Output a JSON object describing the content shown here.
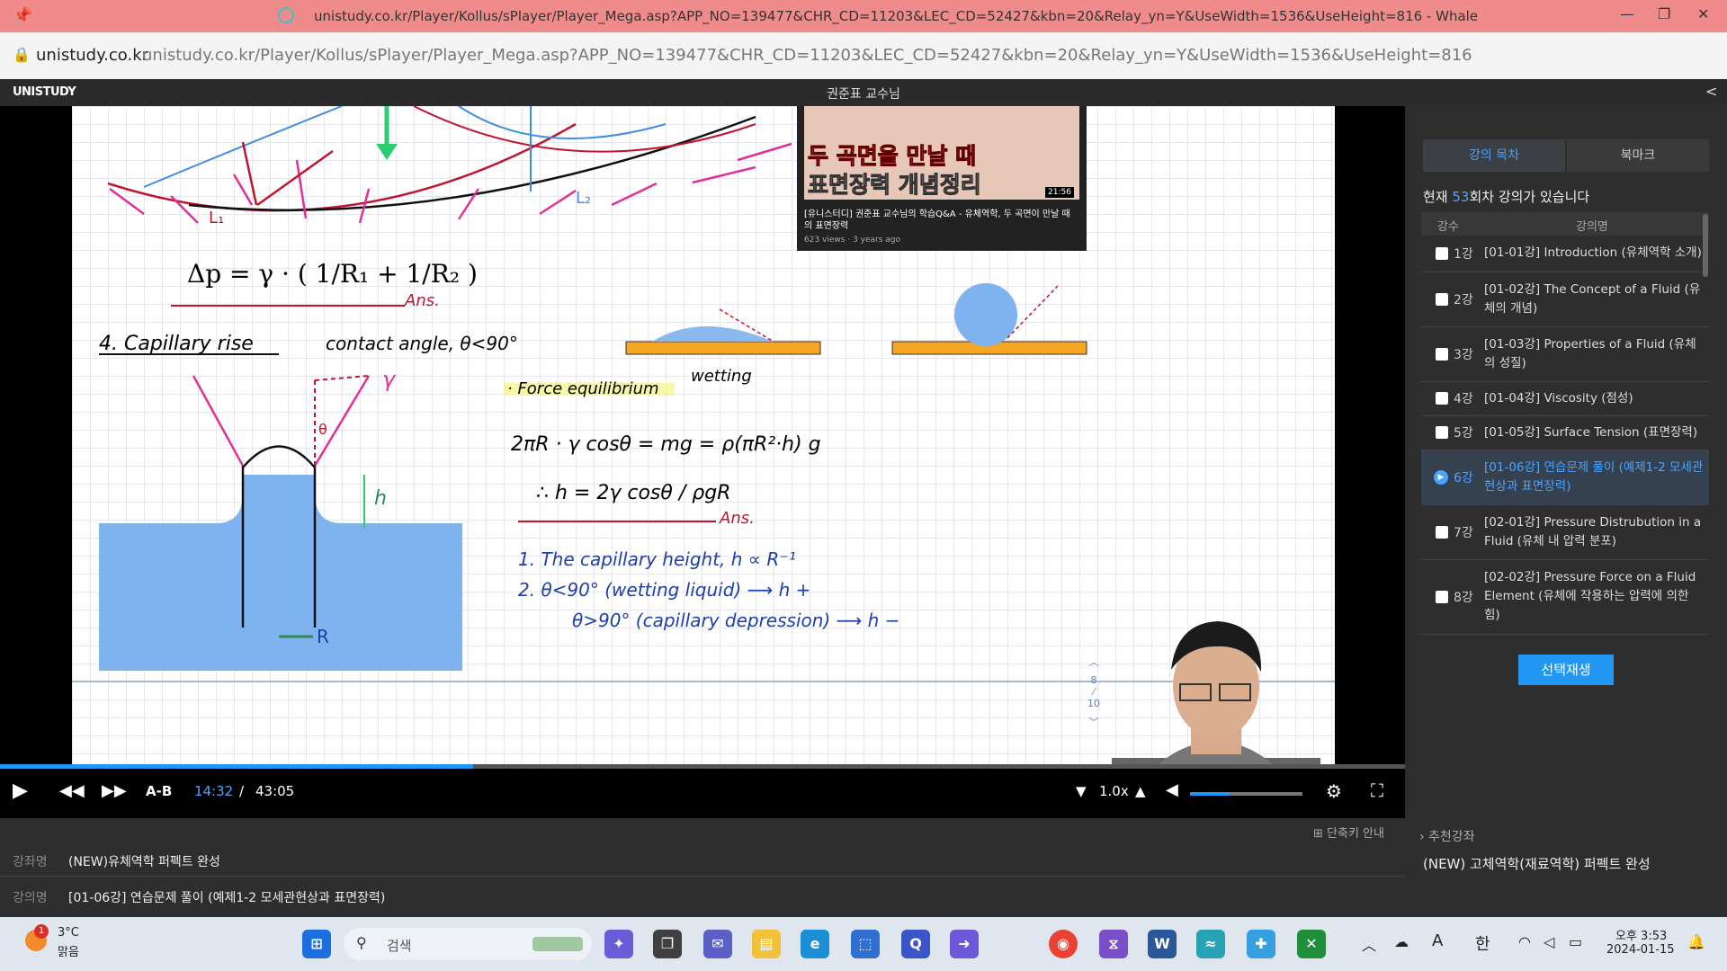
{
  "window": {
    "title": "unistudy.co.kr/Player/Kollus/sPlayer/Player_Mega.asp?APP_NO=139477&CHR_CD=11203&LEC_CD=52427&kbn=20&Relay_yn=Y&UseWidth=1536&UseHeight=816 - Whale",
    "controls": {
      "minimize": "—",
      "restore": "❐",
      "close": "✕"
    }
  },
  "address_bar": {
    "host": "unistudy.co.kr",
    "url": "unistudy.co.kr/Player/Kollus/sPlayer/Player_Mega.asp?APP_NO=139477&CHR_CD=11203&LEC_CD=52427&kbn=20&Relay_yn=Y&UseWidth=1536&UseHeight=816"
  },
  "app_header": {
    "logo": "UNISTUDY",
    "professor": "권준표 교수님"
  },
  "video": {
    "thumbnail": {
      "line1": "두 곡면을 만날 때",
      "line2": "표면장력 개념정리",
      "duration": "21:56",
      "caption": "[유니스터디] 권준표 교수님의 학습Q&A - 유체역학, 두 곡면이 만날 때의 표면장력",
      "views": "623 views · 3 years ago"
    },
    "board": {
      "formula1": "Δp = γ · ( 1/R₁ + 1/R₂ )",
      "ans1": "Ans.",
      "heading": "4. Capillary rise",
      "contact": "contact angle, θ<90°",
      "wetting": "wetting",
      "force_eq": "· Force equilibrium",
      "eq1": "2πR · γ cosθ = mg = ρ(πR²·h) g",
      "eq2": "∴ h = 2γ cosθ / ρgR",
      "ans2": "Ans.",
      "note1": "1. The capillary height, h ∝ R⁻¹",
      "note2a": "2. θ<90° (wetting liquid) ⟶ h +",
      "note2b": "θ>90° (capillary depression) ⟶ h −",
      "label_gamma": "γ",
      "label_theta": "θ",
      "label_h": "h",
      "label_R": "R",
      "label_L1": "L₁",
      "label_L2": "L₂"
    },
    "page_nav": {
      "current": "8",
      "total": "10"
    },
    "progress": 0.337
  },
  "player": {
    "ab_label": "A-B",
    "current_time": "14:32",
    "separator": "/",
    "duration": "43:05",
    "speed": "1.0x",
    "volume": 0.35
  },
  "info": {
    "shortcut": "단축키 안내",
    "course_label": "강좌명",
    "course_value": "(NEW)유체역학 퍼펙트 완성",
    "lecture_label": "강의명",
    "lecture_value": "[01-06강] 연습문제 풀이 (예제1-2 모세관현상과 표면장력)"
  },
  "sidebar": {
    "tabs": [
      "강의 목차",
      "북마크"
    ],
    "count_prefix": "현재 ",
    "count_value": "53",
    "count_suffix": "회차 강의가 있습니다",
    "col_num": "강수",
    "col_title": "강의명",
    "lectures": [
      {
        "num": "1강",
        "title": "[01-01강] Introduction (유체역학 소개)"
      },
      {
        "num": "2강",
        "title": "[01-02강] The Concept of a Fluid (유체의 개념)"
      },
      {
        "num": "3강",
        "title": "[01-03강] Properties of a Fluid (유체의 성질)"
      },
      {
        "num": "4강",
        "title": "[01-04강] Viscosity (점성)"
      },
      {
        "num": "5강",
        "title": "[01-05강] Surface Tension (표면장력)"
      },
      {
        "num": "6강",
        "title": "[01-06강] 연습문제 풀이 (예제1-2 모세관현상과 표면장력)"
      },
      {
        "num": "7강",
        "title": "[02-01강] Pressure Distrubution in a Fluid (유체 내 압력 분포)"
      },
      {
        "num": "8강",
        "title": "[02-02강] Pressure Force on a Fluid Element (유체에 작용하는 압력에 의한 힘)"
      }
    ],
    "play_selected": "선택재생",
    "recommend_label": "› 추천강좌",
    "recommend_value": "(NEW) 고체역학(재료역학) 퍼펙트 완성"
  },
  "taskbar": {
    "weather_temp": "3°C",
    "weather_desc": "맑음",
    "weather_badge": "1",
    "search": "검색",
    "ime": "한",
    "font_icon": "A",
    "time": "오후 3:53",
    "date": "2024-01-15"
  }
}
